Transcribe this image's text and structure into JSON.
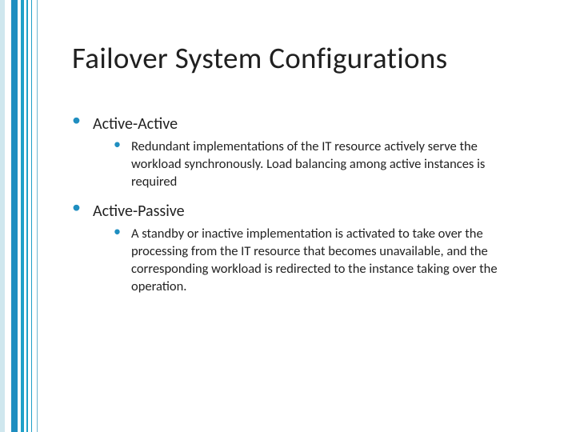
{
  "title": "Failover System Configurations",
  "items": [
    {
      "label": "Active-Active",
      "desc": "Redundant implementations of the IT resource actively serve the workload synchronously. Load balancing among active instances is required"
    },
    {
      "label": "Active-Passive",
      "desc": "A standby or inactive implementation is activated to take over the processing from the IT resource that becomes unavailable, and the corresponding workload is redirected to the instance taking over the operation."
    }
  ]
}
